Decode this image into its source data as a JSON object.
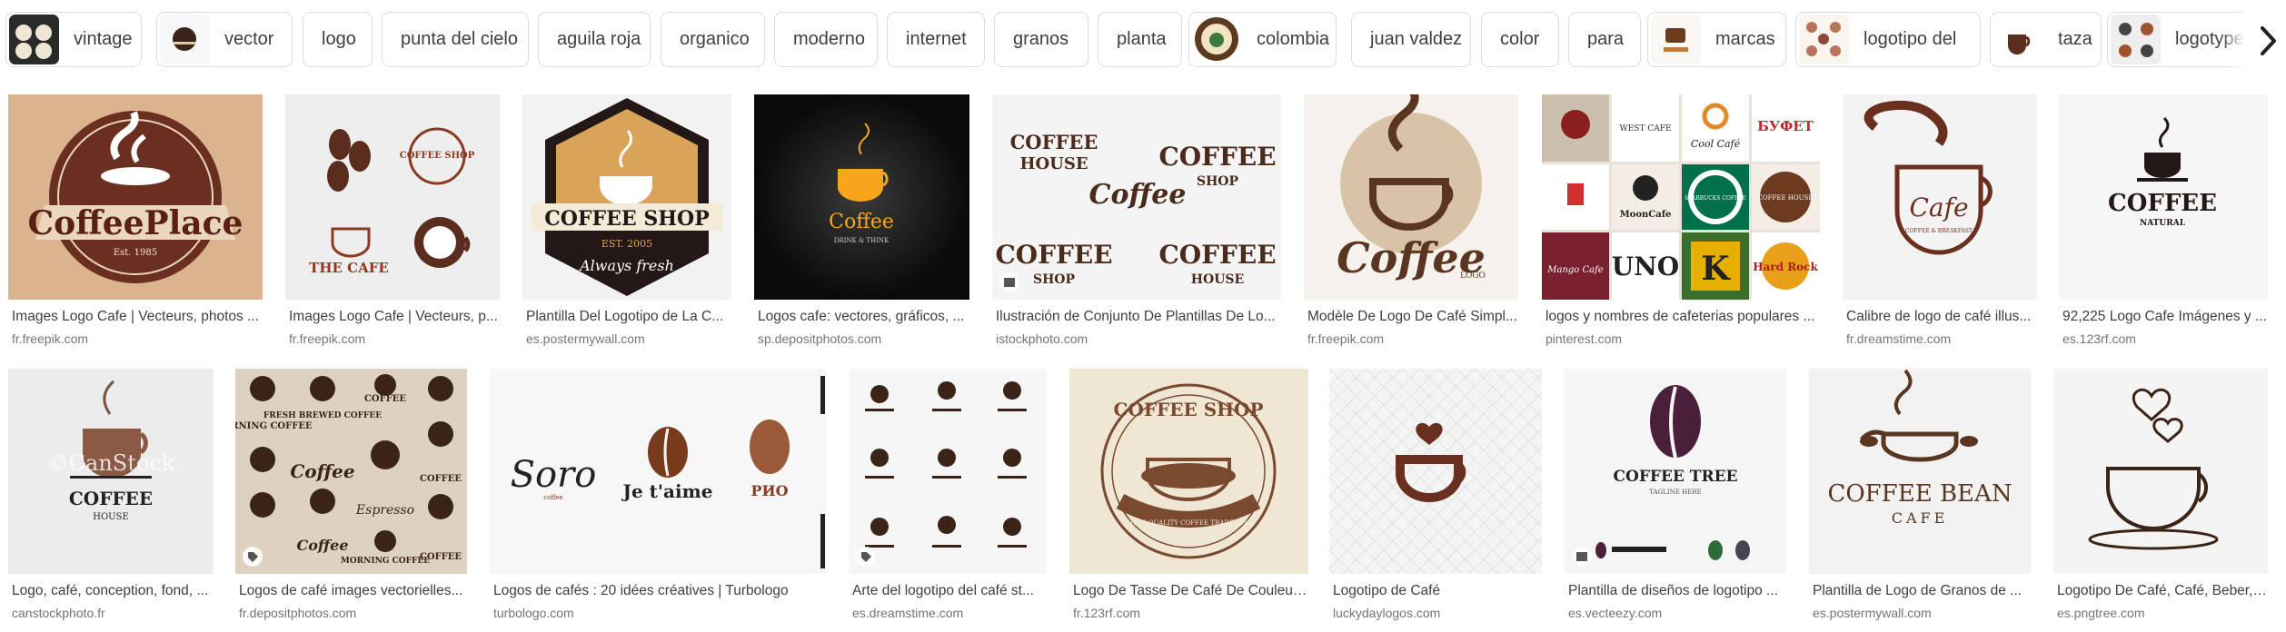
{
  "filter_chips": [
    {
      "label": "vintage",
      "thumb": true
    },
    {
      "label": "vector",
      "thumb": true
    },
    {
      "label": "logo",
      "thumb": false
    },
    {
      "label": "punta del cielo",
      "thumb": false
    },
    {
      "label": "aguila roja",
      "thumb": false
    },
    {
      "label": "organico",
      "thumb": false
    },
    {
      "label": "moderno",
      "thumb": false
    },
    {
      "label": "internet",
      "thumb": false
    },
    {
      "label": "granos",
      "thumb": false
    },
    {
      "label": "planta",
      "thumb": false
    },
    {
      "label": "colombia",
      "thumb": true
    },
    {
      "label": "juan valdez",
      "thumb": false
    },
    {
      "label": "color",
      "thumb": false
    },
    {
      "label": "para",
      "thumb": false
    },
    {
      "label": "marcas",
      "thumb": true
    },
    {
      "label": "logotipo del",
      "thumb": true
    },
    {
      "label": "taza",
      "thumb": true
    },
    {
      "label": "logotype",
      "thumb": true
    }
  ],
  "results_row1": [
    {
      "title": "Images Logo Cafe | Vecteurs, photos ...",
      "source": "fr.freepik.com",
      "logo_text": "CoffeePlace",
      "logo_sub": "Est. 1985"
    },
    {
      "title": "Images Logo Cafe | Vecteurs, p...",
      "source": "fr.freepik.com",
      "logo_text": "THE CAFE",
      "logo_sub": "COFFEE SHOP"
    },
    {
      "title": "Plantilla Del Logotipo de La C...",
      "source": "es.postermywall.com",
      "logo_text": "COFFEE SHOP",
      "logo_sub": "EST. 2005",
      "logo_script": "Always fresh"
    },
    {
      "title": "Logos cafe: vectores, gráficos, ...",
      "source": "sp.depositphotos.com",
      "logo_text": "Coffee",
      "logo_sub": "DRINK & THINK"
    },
    {
      "title": "Ilustración de Conjunto De Plantillas De Lo...",
      "source": "istockphoto.com",
      "logo_text": "COFFEE",
      "logo_sub": "HOUSE",
      "logo_script": "Coffee",
      "logo_extra": "SHOP"
    },
    {
      "title": "Modèle De Logo De Café Simpl...",
      "source": "fr.freepik.com",
      "logo_text": "Coffee",
      "logo_sub": "LOGO"
    },
    {
      "title": "logos y nombres de cafeterias populares ...",
      "source": "pinterest.com",
      "grid_labels": [
        "WEST CAFE",
        "Cool Café",
        "БУФЕТ",
        "MoonCafe",
        "STARBUCKS COFFEE",
        "COFFEE HOUSE",
        "Mango Cafe",
        "UNO",
        "K",
        "Hard Rock"
      ]
    },
    {
      "title": "Calibre de logo de café illus...",
      "source": "fr.dreamstime.com",
      "logo_text": "Cafe",
      "logo_sub": "COFFEE & BREAKFAST"
    },
    {
      "title": "92,225 Logo Cafe Imágenes y ...",
      "source": "es.123rf.com",
      "logo_text": "COFFEE",
      "logo_sub": "NATURAL"
    }
  ],
  "results_row2": [
    {
      "title": "Logo, café, conception, fond, ...",
      "source": "canstockphoto.fr",
      "logo_text": "COFFEE",
      "logo_sub": "HOUSE",
      "watermark": "©CanStock"
    },
    {
      "title": "Logos de café images vectorielles...",
      "source": "fr.depositphotos.com",
      "grid_labels": [
        "MORNING COFFEE",
        "FRESH BREWED COFFEE",
        "COFFEE",
        "Coffee",
        "COFFEE",
        "Espresso",
        "Coffee",
        "MORNING COFFEE",
        "COFFEE"
      ]
    },
    {
      "title": "Logos de cafés : 20 idées créatives | Turbologo",
      "source": "turbologo.com",
      "logo_text": "Soro",
      "logo_sub": "Je t'aime",
      "logo_extra": "PИO"
    },
    {
      "title": "Arte del logotipo del café st...",
      "source": "es.dreamstime.com"
    },
    {
      "title": "Logo De Tasse De Café De Couleur...",
      "source": "fr.123rf.com",
      "logo_text": "COFFEE SHOP",
      "logo_sub": "HIGH QUALITY COFFEE TRADITION"
    },
    {
      "title": "Logotipo de Café",
      "source": "luckydaylogos.com"
    },
    {
      "title": "Plantilla de diseños de logotipo ...",
      "source": "es.vecteezy.com",
      "logo_text": "COFFEE TREE",
      "logo_sub": "TAGLINE HERE"
    },
    {
      "title": "Plantilla de Logo de Granos de ...",
      "source": "es.postermywall.com",
      "logo_text": "COFFEE BEAN",
      "logo_sub": "CAFE"
    },
    {
      "title": "Logotipo De Café, Café, Beber, ...",
      "source": "es.pngtree.com"
    }
  ],
  "colors": {
    "brown": "#5a2d1e",
    "tan": "#d9b48f",
    "chip_border": "#dadce0"
  }
}
